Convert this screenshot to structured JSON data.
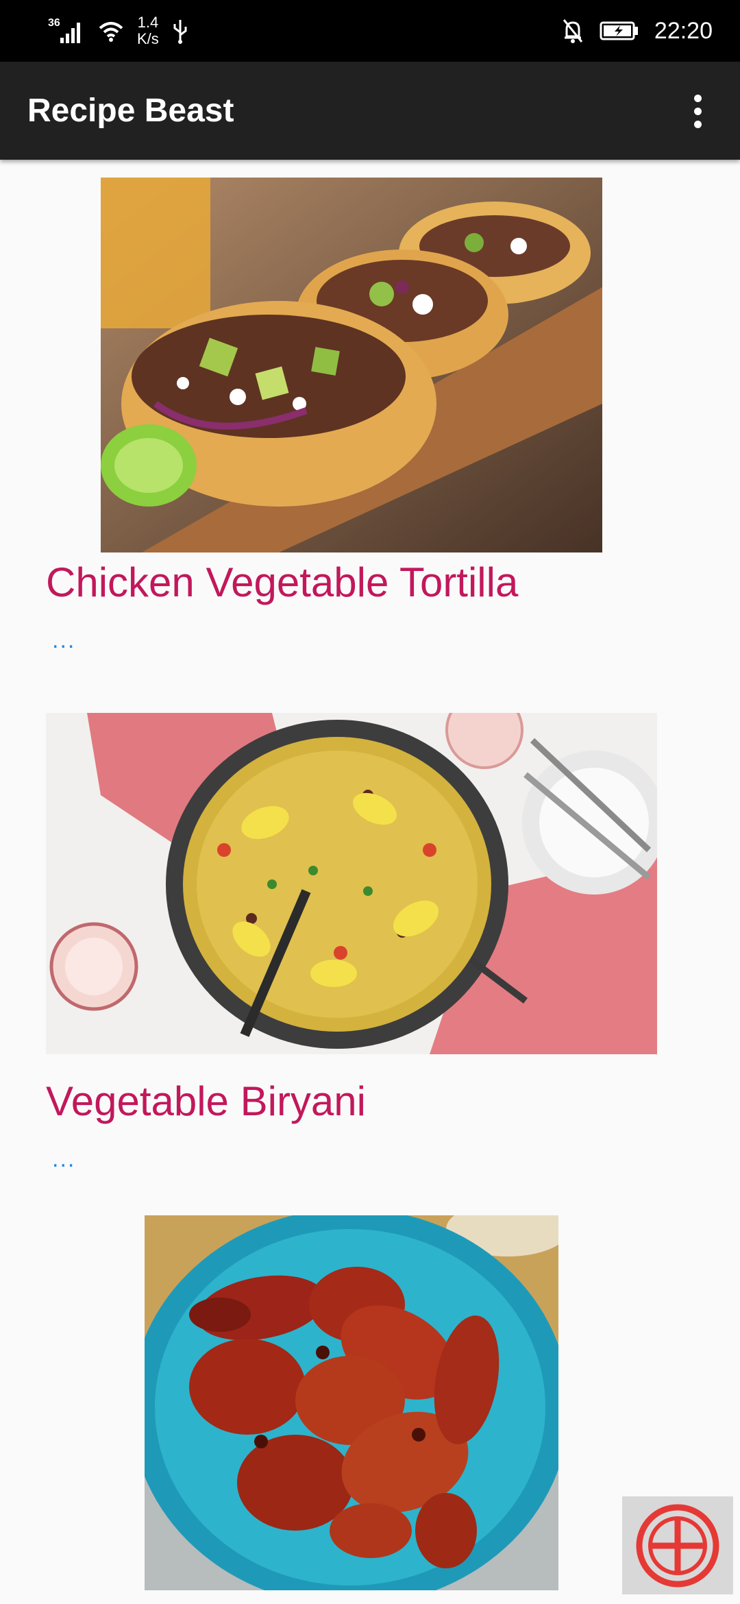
{
  "status_bar": {
    "network_type": "36",
    "speed_value": "1.4",
    "speed_unit": "K/s",
    "time": "22:20",
    "icons": [
      "signal-icon",
      "wifi-icon",
      "usb-icon",
      "mute-notifications-icon",
      "battery-charging-icon"
    ]
  },
  "app_bar": {
    "title": "Recipe Beast",
    "menu_icon": "more-vert-icon"
  },
  "recipes": [
    {
      "title": "Chicken Vegetable Tortilla",
      "more": "...",
      "image": "tacos-photo"
    },
    {
      "title": "Vegetable Biryani",
      "more": "...",
      "image": "paella-pan-photo"
    },
    {
      "title": "",
      "more": "",
      "image": "roasted-chicken-legs-photo"
    }
  ],
  "fab": {
    "icon": "add-circle-icon"
  },
  "colors": {
    "status_bar": "#000000",
    "app_bar": "#212121",
    "recipe_title": "#c2185b",
    "more_link": "#1e88e5",
    "fab_icon": "#e53935"
  }
}
